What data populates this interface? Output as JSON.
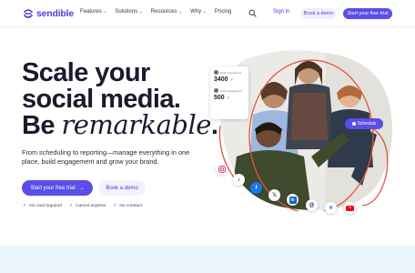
{
  "brand": {
    "name": "sendible",
    "accent": "#5a4ee6"
  },
  "nav": {
    "items": [
      {
        "label": "Features",
        "has_dropdown": true
      },
      {
        "label": "Solutions",
        "has_dropdown": true
      },
      {
        "label": "Resources",
        "has_dropdown": true
      },
      {
        "label": "Why",
        "has_dropdown": true
      },
      {
        "label": "Pricing",
        "has_dropdown": false
      }
    ],
    "search_icon": "search-icon",
    "signin": "Sign in",
    "book_demo": "Book a demo",
    "start_trial": "Start your free trial"
  },
  "hero": {
    "headline_line1": "Scale your",
    "headline_line2": "social media.",
    "headline_be": "Be ",
    "headline_italic": "remarkable",
    "headline_period": ".",
    "subtext": "From scheduling to reporting—manage everything in one place, build engagement and grow your brand.",
    "cta_primary": "Start your free trial",
    "cta_primary_icon": "arrow-right-icon",
    "cta_secondary": "Book a demo",
    "checks": [
      "No card required",
      "Cancel anytime",
      "No contract"
    ]
  },
  "visual": {
    "stats": [
      {
        "label": "Total impressions",
        "value": "3400",
        "trend": "↗"
      },
      {
        "label": "Total engagement",
        "value": "500",
        "trend": "↗"
      }
    ],
    "schedule_label": "Schedule",
    "social_icons": [
      "instagram-icon",
      "tiktok-icon",
      "facebook-icon",
      "x-icon",
      "linkedin-icon",
      "threads-icon",
      "bluesky-icon",
      "youtube-icon"
    ]
  }
}
